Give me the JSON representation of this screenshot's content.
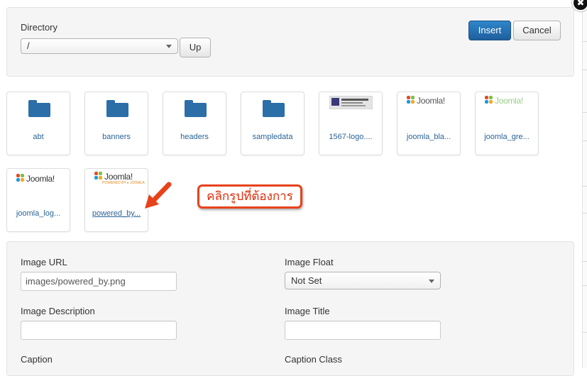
{
  "directory": {
    "label": "Directory",
    "selected": "/",
    "up_label": "Up"
  },
  "actions": {
    "insert_label": "Insert",
    "cancel_label": "Cancel"
  },
  "close_glyph": "✖",
  "thumbnails": [
    {
      "kind": "folder",
      "label": "abt",
      "icon": "folder-icon"
    },
    {
      "kind": "folder",
      "label": "banners",
      "icon": "folder-icon"
    },
    {
      "kind": "folder",
      "label": "headers",
      "icon": "folder-icon"
    },
    {
      "kind": "folder",
      "label": "sampledata",
      "icon": "folder-icon"
    },
    {
      "kind": "image",
      "label": "1567-logo....",
      "icon": "logo-thumbnail"
    },
    {
      "kind": "image",
      "label": "joomla_bla...",
      "icon": "joomla-logo-black"
    },
    {
      "kind": "image",
      "label": "joomla_gre...",
      "icon": "joomla-logo-green"
    },
    {
      "kind": "image",
      "label": "joomla_log...",
      "icon": "joomla-logo"
    },
    {
      "kind": "image",
      "label": "powered_by...",
      "icon": "joomla-powered-by"
    }
  ],
  "logo_text": {
    "joomla": "Joomla!",
    "powered": "POWERED BY ▸ JOOMLA"
  },
  "annotation": {
    "text": "คลิกรูปที่ต้องการ",
    "color": "#e8421c"
  },
  "form": {
    "image_url_label": "Image URL",
    "image_url_value": "images/powered_by.png",
    "image_float_label": "Image Float",
    "image_float_value": "Not Set",
    "image_description_label": "Image Description",
    "image_description_value": "",
    "image_title_label": "Image Title",
    "image_title_value": "",
    "caption_label": "Caption",
    "caption_class_label": "Caption Class"
  },
  "colors": {
    "primary_button": "#2e86c9",
    "link": "#2a6496",
    "folder": "#2c6ea8",
    "panel_bg": "#f5f5f5"
  }
}
